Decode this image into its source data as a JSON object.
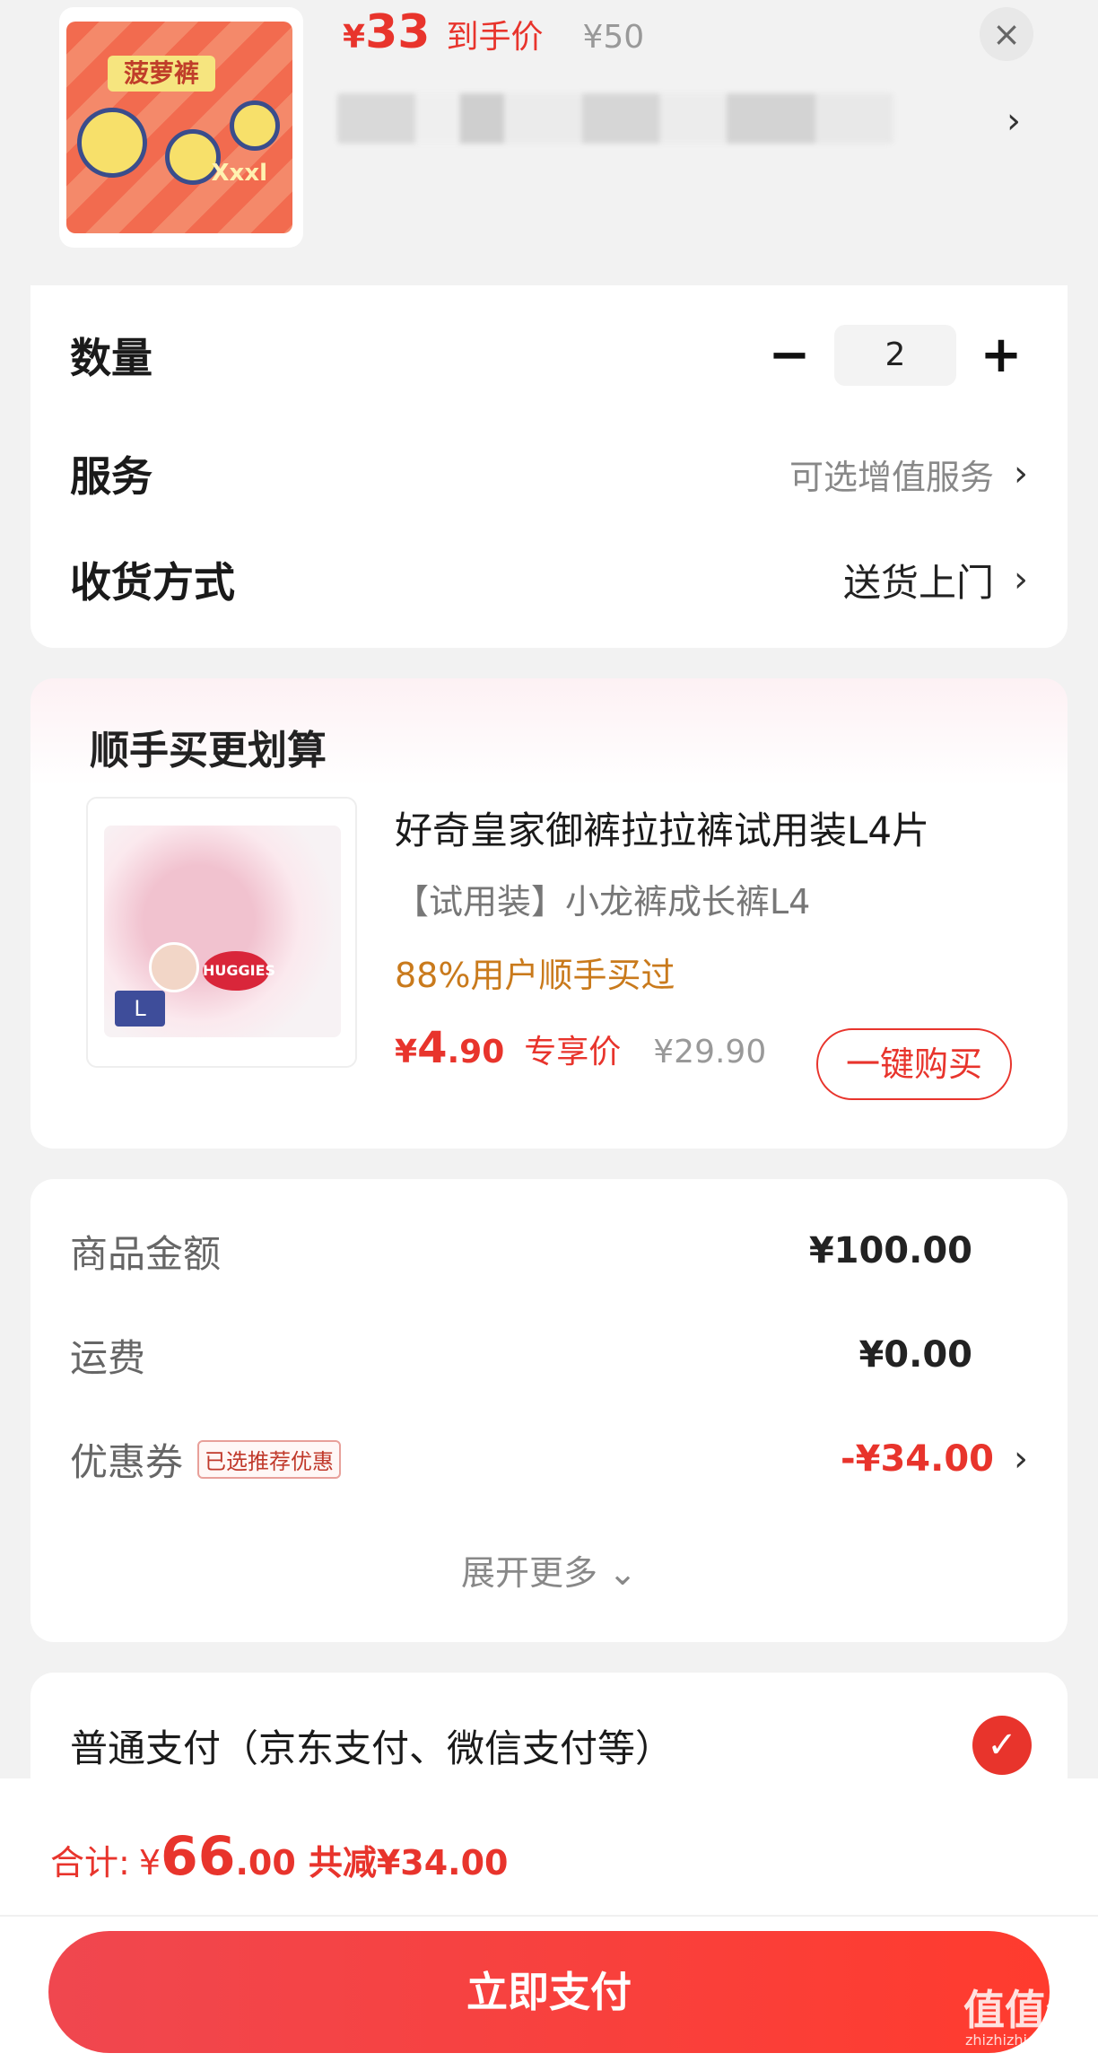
{
  "product": {
    "price_symbol": "¥",
    "price": "33",
    "price_label": "到手价",
    "original_price": "¥50",
    "close_icon": "close-icon",
    "pack_brand": "菠萝裤",
    "pack_size": "Xxxl"
  },
  "options": {
    "quantity_label": "数量",
    "quantity_value": "2",
    "minus": "−",
    "plus": "+",
    "service_label": "服务",
    "service_value": "可选增值服务",
    "delivery_label": "收货方式",
    "delivery_value": "送货上门",
    "chevron": "›"
  },
  "upsell": {
    "title": "顺手买更划算",
    "name": "好奇皇家御裤拉拉裤试用装L4片",
    "subtitle": "【试用装】小龙裤成长裤L4",
    "buyers": "88%用户顺手买过",
    "price_symbol": "¥",
    "price_int": "4",
    "price_dec": ".90",
    "price_label": "专享价",
    "original_price": "¥29.90",
    "buy_button": "一键购买",
    "brand": "HUGGIES",
    "size": "L"
  },
  "summary": {
    "goods_label": "商品金额",
    "goods_value": "¥100.00",
    "shipping_label": "运费",
    "shipping_value": "¥0.00",
    "coupon_label": "优惠券",
    "coupon_tag": "已选推荐优惠",
    "coupon_value": "-¥34.00",
    "expand": "展开更多 ⌄"
  },
  "payment": {
    "method": "普通支付（京东支付、微信支付等）",
    "check": "✓"
  },
  "footer": {
    "total_label": "合计:",
    "total_symbol": "¥",
    "total_int": "66",
    "total_dec": ".00",
    "saved": "共减¥34.00",
    "pay_button": "立即支付",
    "watermark": "值值值",
    "watermark_sub": "zhizhizhi.com"
  },
  "colors": {
    "accent": "#e8342c",
    "orange": "#c97a1c"
  }
}
